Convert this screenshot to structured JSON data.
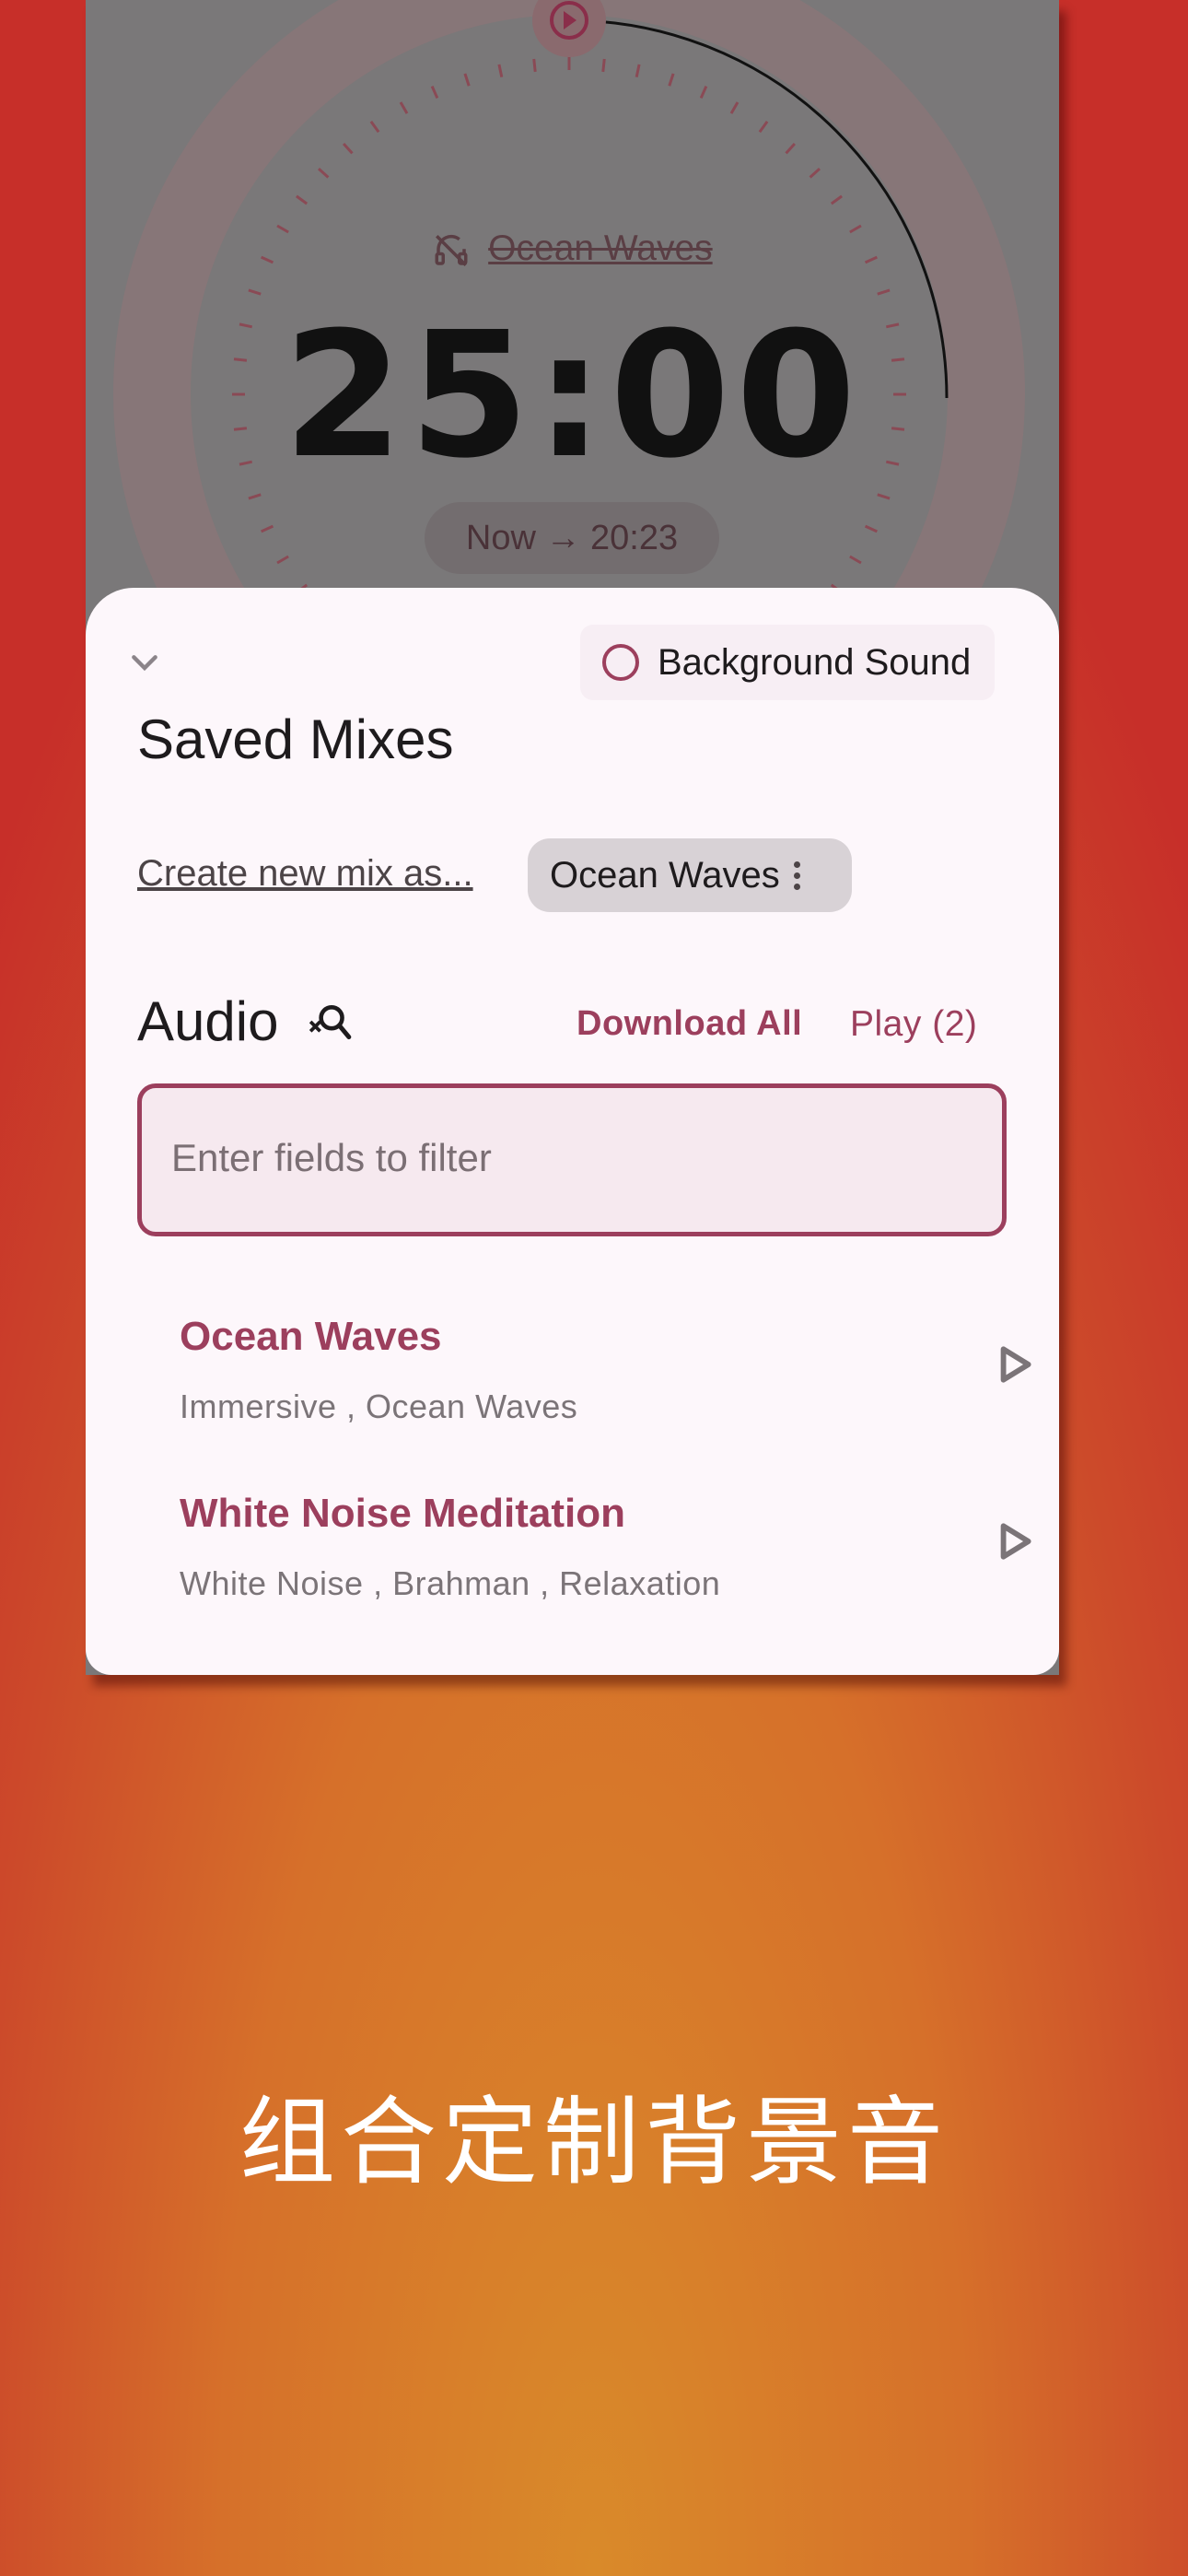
{
  "timer_screen": {
    "sound_name": "Ocean Waves",
    "time": "25:00",
    "eta_prefix": "Now",
    "eta_time": "20:23"
  },
  "sheet": {
    "background_sound_label": "Background Sound",
    "saved_mixes_title": "Saved Mixes",
    "create_mix_link": "Create new mix as...",
    "current_mix_chip": "Ocean Waves",
    "audio_title": "Audio",
    "download_all_label": "Download All",
    "play_label": "Play (2)",
    "filter_placeholder": "Enter fields to filter",
    "tracks": [
      {
        "title": "Ocean Waves",
        "tags": "Immersive , Ocean Waves"
      },
      {
        "title": "White Noise Meditation",
        "tags": "White Noise , Brahman , Relaxation"
      }
    ]
  },
  "caption": "组合定制背景音",
  "colors": {
    "accent": "#9c3f5d",
    "sheet_bg": "#fdf7fb",
    "overlay_bg": "#7a7879"
  },
  "icons": [
    "play-circle-icon",
    "music-off-icon",
    "chevron-down-icon",
    "radio-unchecked-icon",
    "more-vert-icon",
    "search-off-icon",
    "play-arrow-icon",
    "arrow-right-icon"
  ]
}
